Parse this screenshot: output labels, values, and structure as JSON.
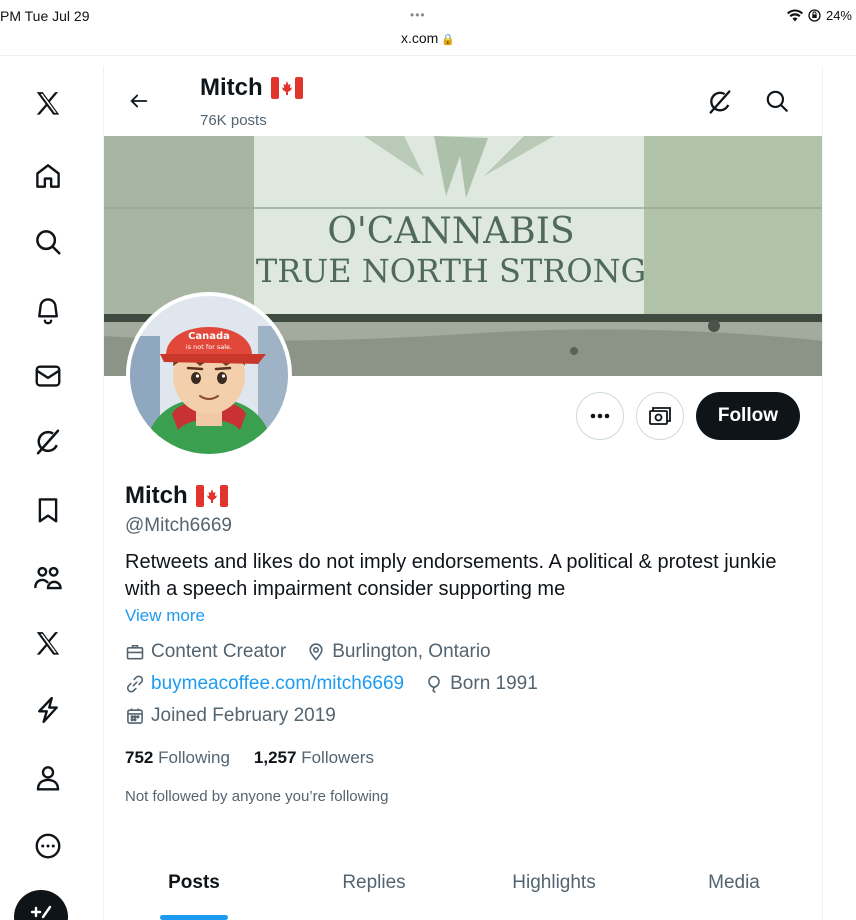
{
  "status_bar": {
    "time": "PM  Tue Jul 29",
    "dots": "•••",
    "url": "x.com",
    "battery": "24%"
  },
  "header": {
    "name": "Mitch",
    "posts": "76K posts"
  },
  "banner": {
    "line1": "O'CANNABIS",
    "line2": "TRUE NORTH STRONG"
  },
  "avatar": {
    "cap_text_1": "Canada",
    "cap_text_2": "is not for sale."
  },
  "actions": {
    "follow_label": "Follow"
  },
  "profile": {
    "name": "Mitch",
    "handle": "@Mitch6669",
    "bio": "Retweets and likes do not imply endorsements. A political & protest junkie with a speech impairment consider supporting me",
    "view_more": "View more",
    "category": "Content Creator",
    "location": "Burlington, Ontario",
    "website": "buymeacoffee.com/mitch6669",
    "born": "Born 1991",
    "joined": "Joined February 2019",
    "following_count": "752",
    "following_label": "Following",
    "followers_count": "1,257",
    "followers_label": "Followers",
    "not_followed": "Not followed by anyone you’re following"
  },
  "tabs": [
    {
      "label": "Posts",
      "active": true
    },
    {
      "label": "Replies",
      "active": false
    },
    {
      "label": "Highlights",
      "active": false
    },
    {
      "label": "Media",
      "active": false
    }
  ],
  "icons": {
    "nav": [
      "x-logo-icon",
      "home-icon",
      "search-icon",
      "notifications-icon",
      "messages-icon",
      "grok-icon",
      "bookmarks-icon",
      "communities-icon",
      "premium-icon",
      "verified-orgs-icon",
      "profile-icon",
      "more-icon"
    ],
    "accent": "#1d9bf0",
    "text_secondary": "#536471"
  }
}
